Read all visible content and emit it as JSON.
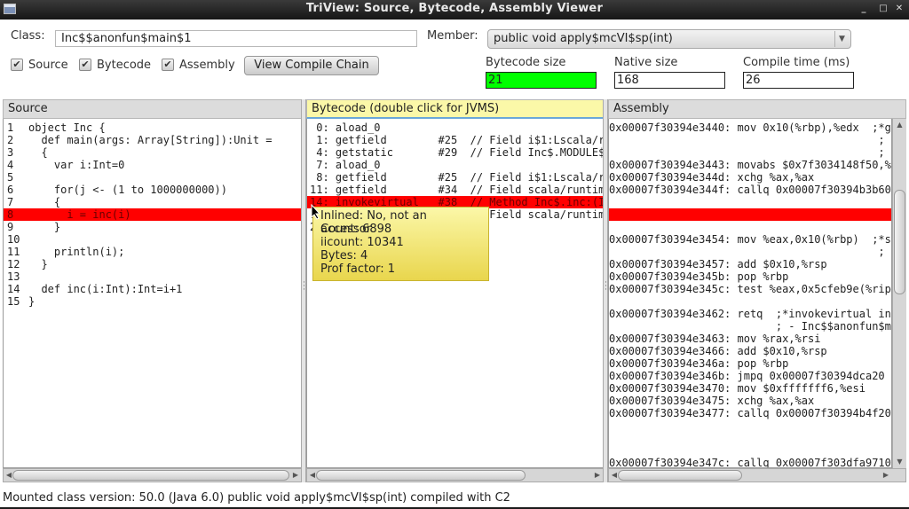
{
  "window": {
    "title": "TriView: Source, Bytecode, Assembly Viewer",
    "buttons": {
      "minimize": "_",
      "maximize": "□",
      "close": "✕"
    }
  },
  "toolbar": {
    "class_label": "Class:",
    "class_value": "Inc$$anonfun$main$1",
    "member_label": "Member:",
    "member_value": "public void apply$mcVI$sp(int)",
    "checkboxes": [
      {
        "label": "Source",
        "checked": true
      },
      {
        "label": "Bytecode",
        "checked": true
      },
      {
        "label": "Assembly",
        "checked": true
      }
    ],
    "check_glyph": "✔",
    "compile_chain_button": "View Compile Chain",
    "metrics": {
      "bytecode_size_label": "Bytecode size",
      "bytecode_size_value": "21",
      "bytecode_size_color": "#00ff00",
      "native_size_label": "Native size",
      "native_size_value": "168",
      "compile_time_label": "Compile time (ms)",
      "compile_time_value": "26"
    }
  },
  "source": {
    "header": "Source",
    "highlight_color": "#ff0000",
    "lines": [
      {
        "num": "1",
        "text": "object Inc {"
      },
      {
        "num": "2",
        "text": "  def main(args: Array[String]):Unit ="
      },
      {
        "num": "3",
        "text": "  {"
      },
      {
        "num": "4",
        "text": "    var i:Int=0"
      },
      {
        "num": "5",
        "text": ""
      },
      {
        "num": "6",
        "text": "    for(j <- (1 to 1000000000))"
      },
      {
        "num": "7",
        "text": "    {"
      },
      {
        "num": "8",
        "text": "      i = inc(i)",
        "highlighted": true
      },
      {
        "num": "9",
        "text": "    }"
      },
      {
        "num": "10",
        "text": ""
      },
      {
        "num": "11",
        "text": "    println(i);"
      },
      {
        "num": "12",
        "text": "  }"
      },
      {
        "num": "13",
        "text": ""
      },
      {
        "num": "14",
        "text": "  def inc(i:Int):Int=i+1"
      },
      {
        "num": "15",
        "text": "}"
      }
    ]
  },
  "bytecode": {
    "header": "Bytecode (double click for JVMS)",
    "lines": [
      {
        "text": " 0: aload_0"
      },
      {
        "text": " 1: getfield        #25  // Field i$1:Lscala/r"
      },
      {
        "text": " 4: getstatic       #29  // Field Inc$.MODULE$"
      },
      {
        "text": " 7: aload_0"
      },
      {
        "text": " 8: getfield        #25  // Field i$1:Lscala/r"
      },
      {
        "text": "11: getfield        #34  // Field scala/runtim"
      },
      {
        "text": "14: invokevirtual   #38  // Method Inc$.inc:(I",
        "highlighted": true
      },
      {
        "text": "17: putfield        #34  // Field scala/runtim"
      },
      {
        "text": "20: return"
      }
    ],
    "tooltip": [
      "Inlined: No, not an accessor",
      "Count: 6898",
      "iicount: 10341",
      "Bytes: 4",
      "Prof factor: 1"
    ]
  },
  "assembly": {
    "header": "Assembly",
    "lines": [
      {
        "text": "0x00007f30394e3440: mov 0x10(%rbp),%edx  ;*ge"
      },
      {
        "text": "                                          ; -"
      },
      {
        "text": "                                          ; in"
      },
      {
        "text": "0x00007f30394e3443: movabs $0x7f3034148f50,%"
      },
      {
        "text": "0x00007f30394e344d: xchg %ax,%ax"
      },
      {
        "text": "0x00007f30394e344f: callq 0x00007f30394b3b60"
      },
      {
        "text": ""
      },
      {
        "text": "",
        "highlighted": true
      },
      {
        "text": ""
      },
      {
        "text": "0x00007f30394e3454: mov %eax,0x10(%rbp)  ;*sy"
      },
      {
        "text": "                                          ; -"
      },
      {
        "text": "0x00007f30394e3457: add $0x10,%rsp"
      },
      {
        "text": "0x00007f30394e345b: pop %rbp"
      },
      {
        "text": "0x00007f30394e345c: test %eax,0x5cfeb9e(%rip"
      },
      {
        "text": ""
      },
      {
        "text": "0x00007f30394e3462: retq  ;*invokevirtual inc"
      },
      {
        "text": "                          ; - Inc$$anonfun$ma"
      },
      {
        "text": "0x00007f30394e3463: mov %rax,%rsi"
      },
      {
        "text": "0x00007f30394e3466: add $0x10,%rsp"
      },
      {
        "text": "0x00007f30394e346a: pop %rbp"
      },
      {
        "text": "0x00007f30394e346b: jmpq 0x00007f30394dca20"
      },
      {
        "text": "0x00007f30394e3470: mov $0xfffffff6,%esi"
      },
      {
        "text": "0x00007f30394e3475: xchg %ax,%ax"
      },
      {
        "text": "0x00007f30394e3477: callq 0x00007f30394b4f20"
      },
      {
        "text": ""
      },
      {
        "text": ""
      },
      {
        "text": ""
      },
      {
        "text": "0x00007f30394e347c: callq 0x00007f303dfa9710"
      }
    ]
  },
  "scroll_icons": {
    "left": "◀",
    "right": "▶",
    "up": "▲",
    "down": "▼"
  },
  "status": "Mounted class version: 50.0 (Java 6.0) public void apply$mcVI$sp(int) compiled with C2"
}
